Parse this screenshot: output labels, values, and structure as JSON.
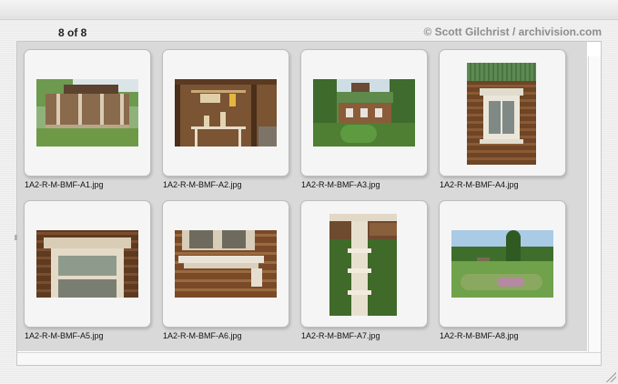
{
  "header": {
    "counter": "8 of 8",
    "copyright": "© Scott Gilchrist / archivision.com"
  },
  "thumbnails": [
    {
      "filename": "1A2-R-M-BMF-A1.jpg",
      "scene": "wooden-veranda-photo"
    },
    {
      "filename": "1A2-R-M-BMF-A2.jpg",
      "scene": "porch-shelf-photo"
    },
    {
      "filename": "1A2-R-M-BMF-A3.jpg",
      "scene": "log-house-garden-photo"
    },
    {
      "filename": "1A2-R-M-BMF-A4.jpg",
      "scene": "carved-window-photo"
    },
    {
      "filename": "1A2-R-M-BMF-A5.jpg",
      "scene": "window-frame-photo"
    },
    {
      "filename": "1A2-R-M-BMF-A6.jpg",
      "scene": "window-sill-photo"
    },
    {
      "filename": "1A2-R-M-BMF-A7.jpg",
      "scene": "carved-post-photo"
    },
    {
      "filename": "1A2-R-M-BMF-A8.jpg",
      "scene": "garden-well-photo"
    }
  ]
}
